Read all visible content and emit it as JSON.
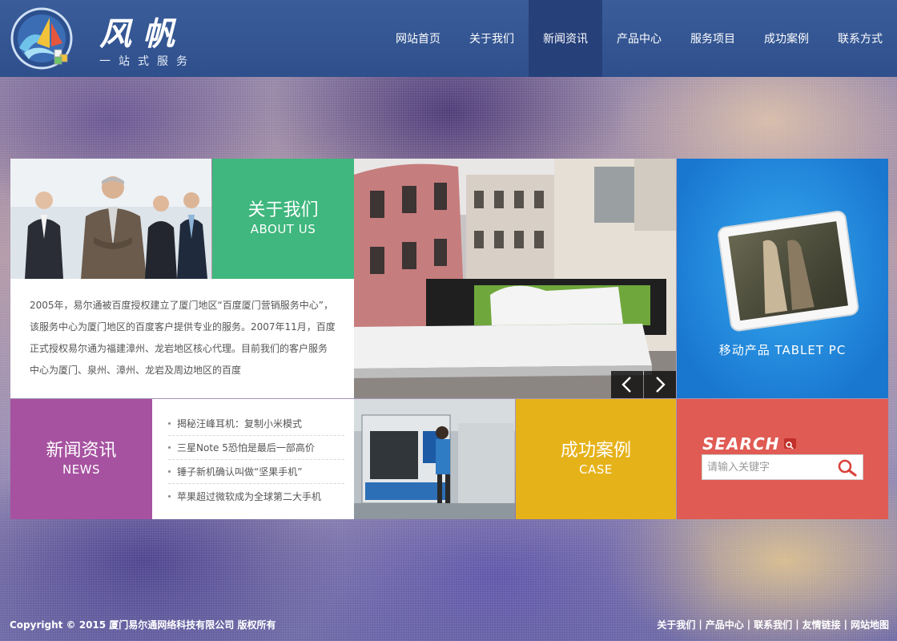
{
  "logo": {
    "title": "风帆",
    "subtitle": "一站式服务"
  },
  "nav": [
    {
      "label": "网站首页",
      "active": false
    },
    {
      "label": "关于我们",
      "active": false
    },
    {
      "label": "新闻资讯",
      "active": true
    },
    {
      "label": "产品中心",
      "active": false
    },
    {
      "label": "服务项目",
      "active": false
    },
    {
      "label": "成功案例",
      "active": false
    },
    {
      "label": "联系方式",
      "active": false
    }
  ],
  "about": {
    "title": "关于我们",
    "title_en": "ABOUT US",
    "text": "2005年，易尔通被百度授权建立了厦门地区“百度厦门营销服务中心”，该服务中心为厦门地区的百度客户提供专业的服务。2007年11月，百度正式授权易尔通为福建漳州、龙岩地区核心代理。目前我们的客户服务中心为厦门、泉州、漳州、龙岩及周边地区的百度"
  },
  "slider": {
    "prev_icon": "chevron-left-icon",
    "next_icon": "chevron-right-icon"
  },
  "tablet": {
    "caption": "移动产品  TABLET PC"
  },
  "news": {
    "title": "新闻资讯",
    "title_en": "NEWS",
    "items": [
      "揭秘汪峰耳机：复制小米模式",
      "三星Note 5恐怕是最后一部高价",
      "锤子新机确认叫做“坚果手机”",
      "苹果超过微软成为全球第二大手机"
    ]
  },
  "case": {
    "title": "成功案例",
    "title_en": "CASE"
  },
  "search": {
    "title": "SEARCH",
    "placeholder": "请输入关键字",
    "value": ""
  },
  "footer": {
    "copyright": "Copyright © 2015 厦门易尔通网络科技有限公司 版权所有",
    "links": [
      "关于我们",
      "产品中心",
      "联系我们",
      "友情链接",
      "网站地图"
    ]
  },
  "colors": {
    "header": "#2f4f8c",
    "nav_active": "#26407a",
    "about_green": "#3fb77e",
    "news_purple": "#a652a0",
    "case_yellow": "#e6b21a",
    "search_red": "#e05b53",
    "tablet_blue": "#1977d0"
  }
}
